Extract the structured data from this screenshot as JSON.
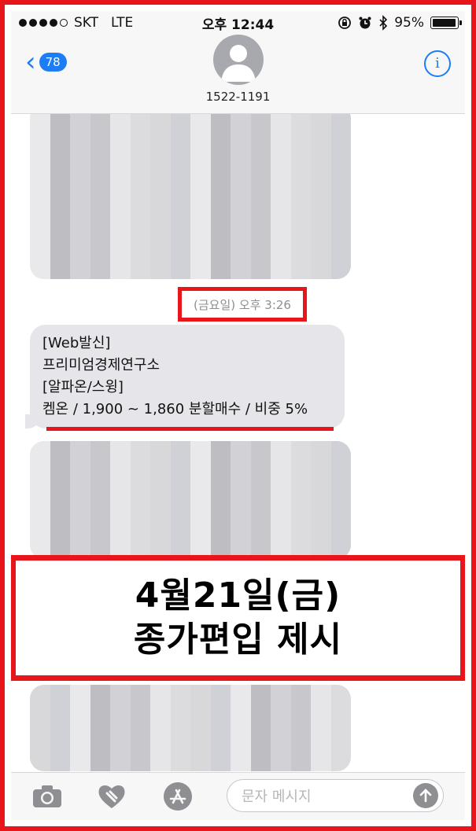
{
  "status": {
    "carrier": "SKT",
    "network": "LTE",
    "time": "오후 12:44",
    "battery": "95%",
    "battery_level": 0.95
  },
  "nav": {
    "back_count": "78",
    "contact": "1522-1191"
  },
  "conversation": {
    "timestamp": "(금요일) 오후 3:26",
    "message_lines": [
      "[Web발신]",
      "프리미엄경제연구소",
      "[알파온/스윙]",
      "켐온 / 1,900 ~ 1,860 분할매수 / 비중 5%"
    ]
  },
  "banner": {
    "line1": "4월21일(금)",
    "line2": "종가편입 제시"
  },
  "composer": {
    "placeholder": "문자 메시지"
  },
  "colors": {
    "accent": "#1d7df4",
    "highlight_red": "#e8161b",
    "bubble_gray": "#e5e5ea"
  }
}
